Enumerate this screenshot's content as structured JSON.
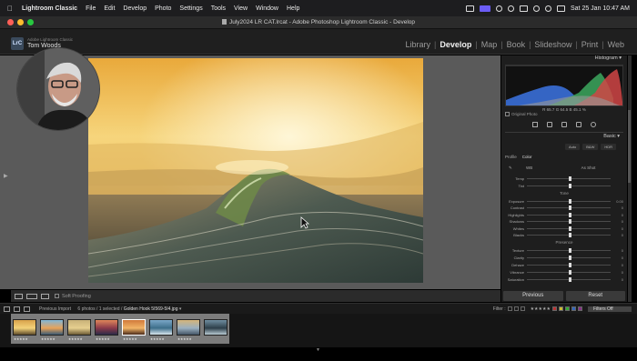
{
  "menubar": {
    "app_name": "Lightroom Classic",
    "items": [
      "File",
      "Edit",
      "Develop",
      "Photo",
      "Settings",
      "Tools",
      "View",
      "Window",
      "Help"
    ],
    "datetime": "Sat 25 Jan 10:47 AM"
  },
  "window": {
    "title": "July2024 LR CAT.lrcat - Adobe Photoshop Lightroom Classic - Develop"
  },
  "identity": {
    "subtitle": "Adobe Lightroom Classic",
    "name": "Tom Woods",
    "badge": "LrC"
  },
  "modules": [
    "Library",
    "Develop",
    "Map",
    "Book",
    "Slideshow",
    "Print",
    "Web"
  ],
  "active_module": "Develop",
  "toolbar": {
    "soft_proofing": "Soft Proofing"
  },
  "right_panel": {
    "histogram_label": "Histogram",
    "histogram_readout": [
      "R",
      "65.7",
      "G",
      "64.5",
      "B",
      "45.1",
      "%"
    ],
    "original_photo": "Original Photo",
    "basic_label": "Basic",
    "wb_buttons": [
      "Auto",
      "B&W",
      "HDR"
    ],
    "treatment_label": "Profile",
    "treatment_value": "Color",
    "wb_label": "WB",
    "wb_value": "As Shot",
    "wb_sliders": [
      {
        "label": "Temp",
        "pos": 0.5
      },
      {
        "label": "Tint",
        "pos": 0.5
      }
    ],
    "tone_label": "Tone",
    "tone_sliders": [
      {
        "label": "Exposure",
        "pos": 0.5,
        "value": "0.00"
      },
      {
        "label": "Contrast",
        "pos": 0.5,
        "value": "0"
      },
      {
        "label": "Highlights",
        "pos": 0.5,
        "value": "0"
      },
      {
        "label": "Shadows",
        "pos": 0.5,
        "value": "0"
      },
      {
        "label": "Whites",
        "pos": 0.5,
        "value": "0"
      },
      {
        "label": "Blacks",
        "pos": 0.5,
        "value": "0"
      }
    ],
    "presence_label": "Presence",
    "presence_sliders": [
      {
        "label": "Texture",
        "pos": 0.5,
        "value": "0"
      },
      {
        "label": "Clarity",
        "pos": 0.5,
        "value": "0"
      },
      {
        "label": "Dehaze",
        "pos": 0.5,
        "value": "0"
      },
      {
        "label": "Vibrance",
        "pos": 0.5,
        "value": "0"
      },
      {
        "label": "Saturation",
        "pos": 0.5,
        "value": "0"
      }
    ],
    "previous_button": "Previous",
    "reset_button": "Reset"
  },
  "filmstrip_header": {
    "source": "Previous Import",
    "count": "6 photos / 1 selected /",
    "filename": "Golden Hook 5I569-5I4.jpg",
    "filter_label": "Filter :",
    "filter_select": "Filters Off"
  },
  "filmstrip": {
    "thumbs": [
      {
        "stars": "★★★★★",
        "colors": [
          "#d9a24a",
          "#f3d27a",
          "#5d4a2a"
        ],
        "selected": false
      },
      {
        "stars": "★★★★★",
        "colors": [
          "#7fb6d8",
          "#e8a35a",
          "#3b5a74"
        ],
        "selected": false
      },
      {
        "stars": "★★★★★",
        "colors": [
          "#c9b279",
          "#e6cf8f",
          "#6b5a34"
        ],
        "selected": false
      },
      {
        "stars": "★★★★★",
        "colors": [
          "#e0865a",
          "#8b3a4a",
          "#2c2a48"
        ],
        "selected": false
      },
      {
        "stars": "★★★★★",
        "colors": [
          "#d07a3a",
          "#f2b466",
          "#4a2a1a"
        ],
        "selected": true
      },
      {
        "stars": "★★★★★",
        "colors": [
          "#7aa7c7",
          "#3d6e8a",
          "#d9e6ee"
        ],
        "selected": false
      },
      {
        "stars": "★★★★★",
        "colors": [
          "#d5b57a",
          "#9ab0c0",
          "#445566"
        ],
        "selected": false
      },
      {
        "stars": "",
        "colors": [
          "#6f8ea0",
          "#2d3f4a",
          "#b9cbd4"
        ],
        "selected": false
      }
    ]
  }
}
